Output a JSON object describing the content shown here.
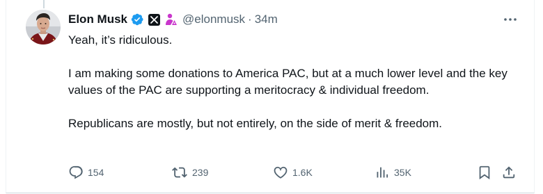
{
  "tweet": {
    "author": {
      "display_name": "Elon Musk",
      "handle": "@elonmusk",
      "verified_badge": "verified-icon",
      "affiliation_badge": "x-logo-icon",
      "government_badge": "government-official-icon"
    },
    "separator": "·",
    "timestamp": "34m",
    "more_icon": "more-icon",
    "paragraphs": [
      "Yeah, it’s ridiculous.",
      "I am making some donations to America PAC, but at a much lower level and the key values of the PAC are supporting a meritocracy & individual freedom.",
      "Republicans are mostly, but not entirely, on the side of merit & freedom."
    ],
    "actions": {
      "reply": {
        "icon": "reply-icon",
        "count": "154"
      },
      "repost": {
        "icon": "repost-icon",
        "count": "239"
      },
      "like": {
        "icon": "like-icon",
        "count": "1.6K"
      },
      "views": {
        "icon": "views-icon",
        "count": "35K"
      },
      "bookmark": {
        "icon": "bookmark-icon"
      },
      "share": {
        "icon": "share-icon"
      }
    }
  },
  "colors": {
    "text": "#0f1419",
    "secondary": "#536471",
    "verified": "#1d9bf0",
    "government": "#c936cc",
    "border": "#cfd9de"
  }
}
